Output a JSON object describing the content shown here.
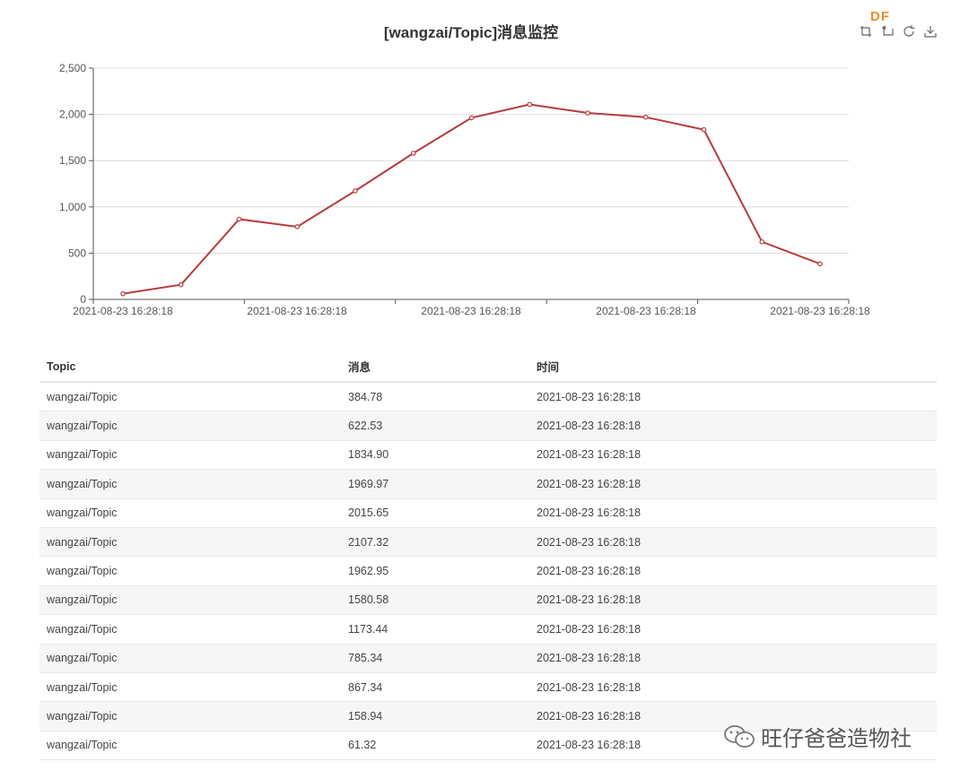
{
  "chart": {
    "title": "[wangzai/Topic]消息监控",
    "brand_logo": "DF",
    "toolbox": [
      {
        "name": "zoom-icon",
        "label": "区域缩放"
      },
      {
        "name": "zoom-reset-icon",
        "label": "缩放还原"
      },
      {
        "name": "refresh-icon",
        "label": "还原"
      },
      {
        "name": "download-icon",
        "label": "保存为图片"
      }
    ]
  },
  "chart_data": {
    "type": "line",
    "title": "[wangzai/Topic]消息监控",
    "x": [
      "2021-08-23 16:28:18",
      "2021-08-23 16:28:18",
      "2021-08-23 16:28:18",
      "2021-08-23 16:28:18",
      "2021-08-23 16:28:18",
      "2021-08-23 16:28:18",
      "2021-08-23 16:28:18",
      "2021-08-23 16:28:18",
      "2021-08-23 16:28:18",
      "2021-08-23 16:28:18",
      "2021-08-23 16:28:18",
      "2021-08-23 16:28:18",
      "2021-08-23 16:28:18"
    ],
    "x_tick_labels": [
      "2021-08-23 16:28:18",
      "2021-08-23 16:28:18",
      "2021-08-23 16:28:18",
      "2021-08-23 16:28:18",
      "2021-08-23 16:28:18"
    ],
    "series": [
      {
        "values": [
          61.32,
          158.94,
          867.34,
          785.34,
          1173.44,
          1580.58,
          1962.95,
          2107.32,
          2015.65,
          1969.97,
          1834.9,
          622.53,
          384.78
        ],
        "color": "#b83b3b"
      }
    ],
    "y_ticks": [
      "0",
      "500",
      "1,000",
      "1,500",
      "2,000",
      "2,500"
    ],
    "ylim": [
      0,
      2500
    ],
    "grid": true,
    "legend": "none"
  },
  "table": {
    "headers": [
      "Topic",
      "消息",
      "时间"
    ],
    "rows": [
      [
        "wangzai/Topic",
        "384.78",
        "2021-08-23 16:28:18"
      ],
      [
        "wangzai/Topic",
        "622.53",
        "2021-08-23 16:28:18"
      ],
      [
        "wangzai/Topic",
        "1834.90",
        "2021-08-23 16:28:18"
      ],
      [
        "wangzai/Topic",
        "1969.97",
        "2021-08-23 16:28:18"
      ],
      [
        "wangzai/Topic",
        "2015.65",
        "2021-08-23 16:28:18"
      ],
      [
        "wangzai/Topic",
        "2107.32",
        "2021-08-23 16:28:18"
      ],
      [
        "wangzai/Topic",
        "1962.95",
        "2021-08-23 16:28:18"
      ],
      [
        "wangzai/Topic",
        "1580.58",
        "2021-08-23 16:28:18"
      ],
      [
        "wangzai/Topic",
        "1173.44",
        "2021-08-23 16:28:18"
      ],
      [
        "wangzai/Topic",
        "785.34",
        "2021-08-23 16:28:18"
      ],
      [
        "wangzai/Topic",
        "867.34",
        "2021-08-23 16:28:18"
      ],
      [
        "wangzai/Topic",
        "158.94",
        "2021-08-23 16:28:18"
      ],
      [
        "wangzai/Topic",
        "61.32",
        "2021-08-23 16:28:18"
      ]
    ]
  },
  "watermark": {
    "text": "旺仔爸爸造物社",
    "icon": "wechat-icon"
  }
}
